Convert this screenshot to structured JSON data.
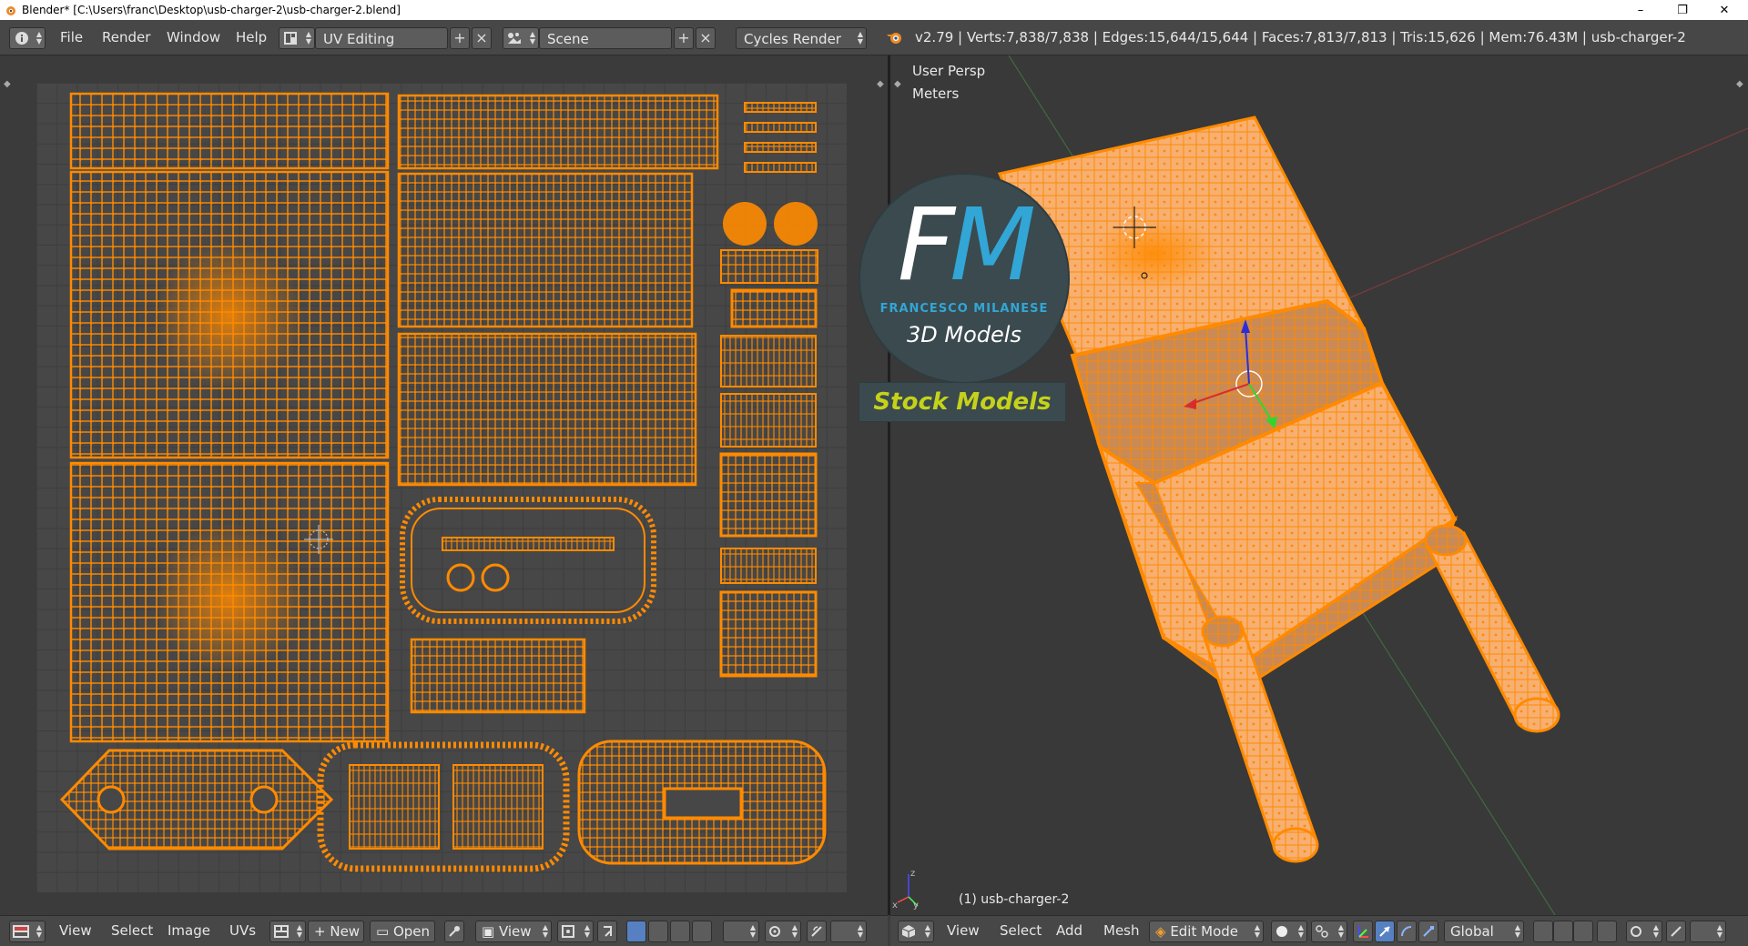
{
  "window": {
    "title": "Blender* [C:\\Users\\franc\\Desktop\\usb-charger-2\\usb-charger-2.blend]",
    "controls": [
      "–",
      "❐",
      "✕"
    ]
  },
  "topbar": {
    "menus": [
      "File",
      "Render",
      "Window",
      "Help"
    ],
    "screen_layout": "UV Editing",
    "scene": "Scene",
    "render_engine": "Cycles Render",
    "stats": "v2.79 | Verts:7,838/7,838 | Edges:15,644/15,644 | Faces:7,813/7,813 | Tris:15,626 | Mem:76.43M | usb-charger-2"
  },
  "viewport": {
    "view_name": "User Persp",
    "units": "Meters",
    "object_label": "(1) usb-charger-2"
  },
  "watermark": {
    "letters_f": "F",
    "letters_m": "M",
    "name": "FRANCESCO MILANESE",
    "subtitle": "3D Models",
    "banner": "Stock Models"
  },
  "uv_footer": {
    "menus": [
      "View",
      "Select",
      "Image",
      "UVs"
    ],
    "new_label": "New",
    "open_label": "Open",
    "view_label": "View"
  },
  "viewport_footer": {
    "menus": [
      "View",
      "Select",
      "Add",
      "Mesh"
    ],
    "mode": "Edit Mode",
    "orientation": "Global"
  },
  "colors": {
    "mesh_wire": "#ff8a00",
    "mesh_face": "#f7b072",
    "accent_blue": "#32a6d6",
    "stock_yellow": "#c5d21a"
  },
  "icons": [
    "info-icon",
    "screen-layout-icon",
    "scene-icon",
    "blender-logo-icon",
    "editor-type-icon",
    "pin-icon",
    "sync-icon",
    "cube-icon",
    "pivot-icon",
    "manipulator-icon",
    "snap-icon"
  ]
}
